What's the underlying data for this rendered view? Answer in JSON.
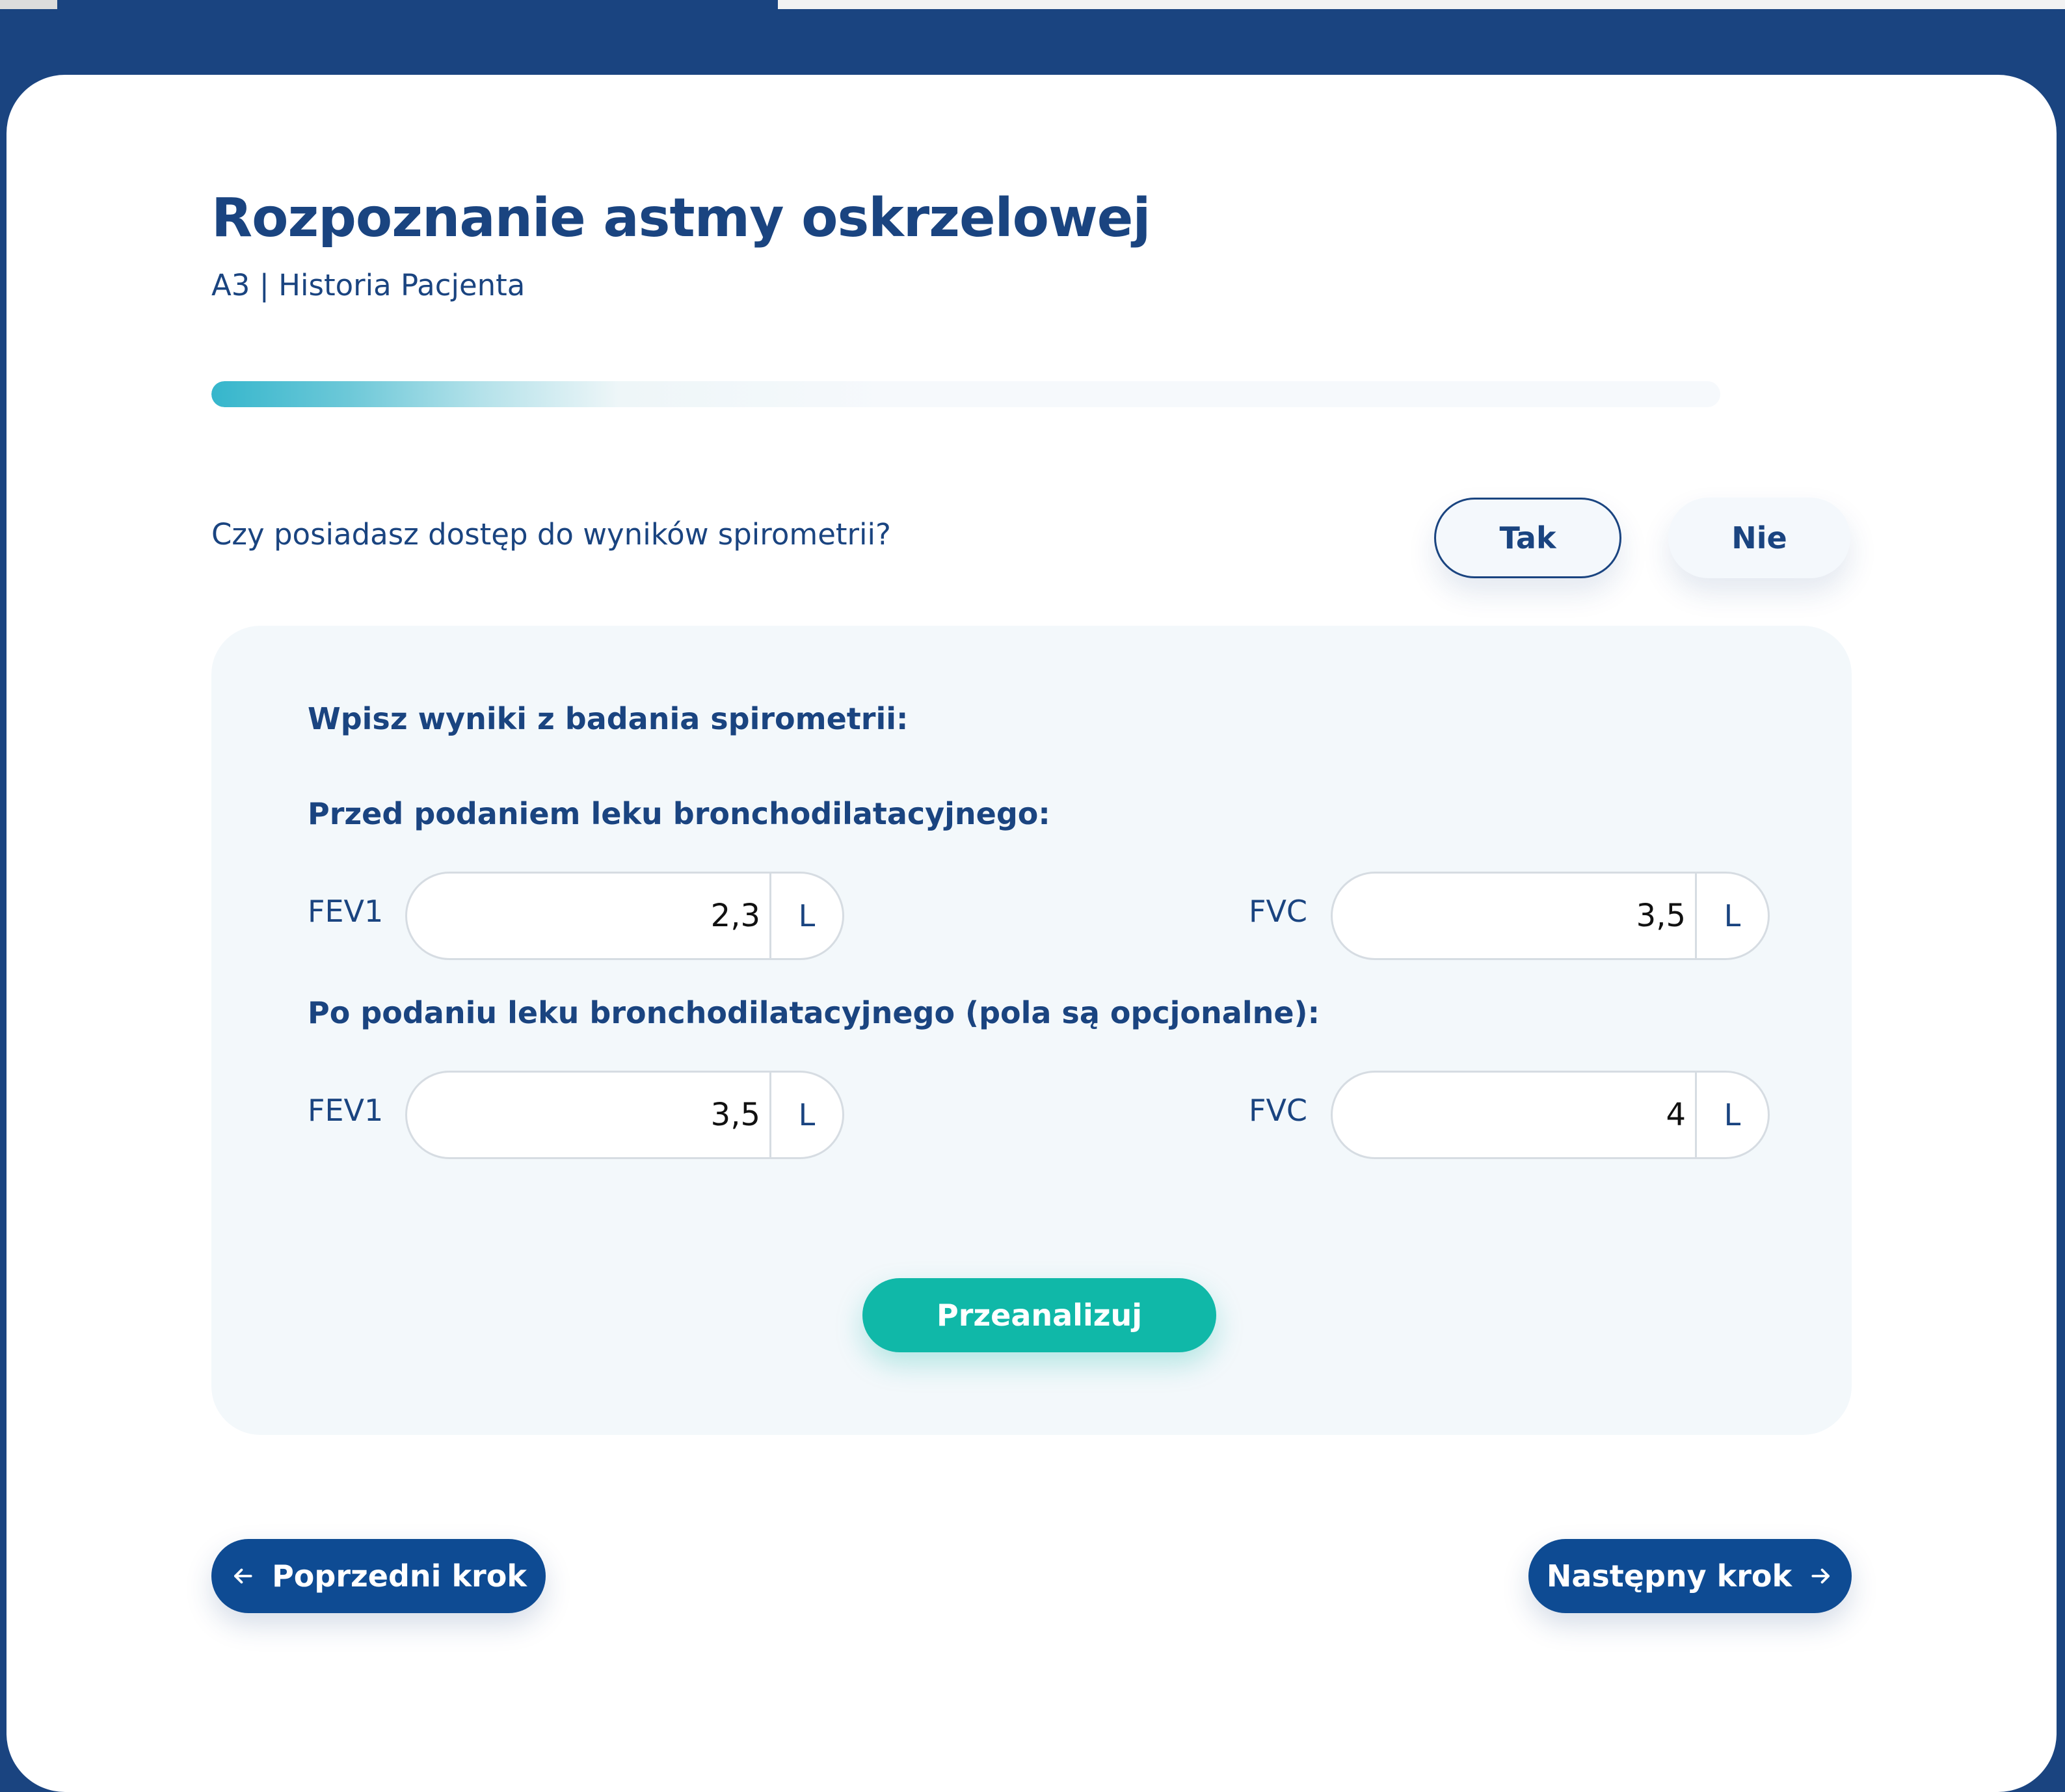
{
  "page": {
    "title": "Rozpoznanie astmy oskrzelowej",
    "subtitle": "A3 | Historia Pacjenta",
    "progress": 0.45
  },
  "question": {
    "text": "Czy posiadasz dostęp do wyników spirometrii?",
    "yes_label": "Tak",
    "no_label": "Nie",
    "selected": "yes"
  },
  "spirometry": {
    "heading": "Wpisz wyniki z badania spirometrii:",
    "before": {
      "heading": "Przed podaniem leku bronchodilatacyjnego:",
      "fev1": {
        "label": "FEV1",
        "value": "2,3",
        "unit": "L"
      },
      "fvc": {
        "label": "FVC",
        "value": "3,5",
        "unit": "L"
      }
    },
    "after": {
      "heading": "Po podaniu leku bronchodilatacyjnego (pola są opcjonalne):",
      "fev1": {
        "label": "FEV1",
        "value": "3,5",
        "unit": "L"
      },
      "fvc": {
        "label": "FVC",
        "value": "4",
        "unit": "L"
      }
    },
    "analyze_label": "Przeanalizuj"
  },
  "navigation": {
    "prev_label": "Poprzedni krok",
    "next_label": "Następny krok"
  },
  "icons": {
    "prev": "arrow-left-icon",
    "next": "arrow-right-icon"
  },
  "colors": {
    "brand": "#1a4480",
    "accent": "#10b8a8",
    "nav_button": "#0e4b93",
    "panel": "#f3f8fb"
  }
}
